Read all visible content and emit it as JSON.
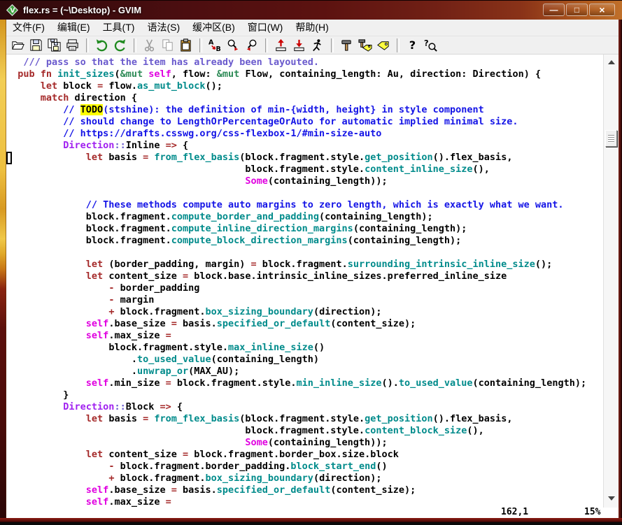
{
  "window": {
    "title": "flex.rs = (~\\Desktop) - GVIM",
    "app": "GVIM",
    "controls": {
      "minimize": "—",
      "maximize": "□",
      "close": "×"
    }
  },
  "menu": {
    "items": [
      {
        "id": "file",
        "label": "文件(F)"
      },
      {
        "id": "edit",
        "label": "编辑(E)"
      },
      {
        "id": "tools",
        "label": "工具(T)"
      },
      {
        "id": "syntax",
        "label": "语法(S)"
      },
      {
        "id": "buffers",
        "label": "缓冲区(B)"
      },
      {
        "id": "window",
        "label": "窗口(W)"
      },
      {
        "id": "help",
        "label": "帮助(H)"
      }
    ]
  },
  "toolbar": {
    "buttons": [
      "open-file",
      "save-file",
      "save-all",
      "print",
      "separator",
      "undo",
      "redo",
      "separator",
      "cut",
      "copy",
      "paste",
      "separator",
      "find-replace",
      "find-next",
      "find-prev",
      "separator",
      "load-session",
      "save-session",
      "run-script",
      "separator",
      "make",
      "build-tags",
      "jump-to-tag",
      "separator",
      "help",
      "find-help"
    ]
  },
  "editor": {
    "cursor": {
      "line_on_screen": 9,
      "column": 1,
      "style": "hollow-block"
    },
    "syntax_colors": {
      "keyword": "#a52a2a",
      "function": "#008b8b",
      "comment": "#1414e6",
      "doc_comment": "#6a5acd",
      "constant": "#e000e0",
      "storage": "#2e8b57",
      "module_path": "#a020f0",
      "todo_fg": "#000000",
      "todo_bg": "#ffff00"
    },
    "lines": [
      {
        "i": 3,
        "t": [
          [
            "d",
            "/// pass so that the item has already been layouted."
          ]
        ]
      },
      {
        "i": 2,
        "t": [
          [
            "k",
            "pub fn "
          ],
          [
            "f",
            "init_sizes"
          ],
          [
            "n",
            "("
          ],
          [
            "g",
            "&mut"
          ],
          [
            "n",
            " "
          ],
          [
            "m",
            "self"
          ],
          [
            "n",
            ", flow: "
          ],
          [
            "g",
            "&mut"
          ],
          [
            "n",
            " Flow, containing_length: Au, direction: Direction) {"
          ]
        ]
      },
      {
        "i": 6,
        "t": [
          [
            "k",
            "let"
          ],
          [
            "n",
            " block "
          ],
          [
            "o",
            "="
          ],
          [
            "n",
            " flow."
          ],
          [
            "f",
            "as_mut_block"
          ],
          [
            "n",
            "();"
          ]
        ]
      },
      {
        "i": 6,
        "t": [
          [
            "k",
            "match"
          ],
          [
            "n",
            " direction {"
          ]
        ]
      },
      {
        "i": 10,
        "t": [
          [
            "c",
            "// "
          ],
          [
            "t",
            "TODO"
          ],
          [
            "c",
            "(stshine): the definition of min-{width, height} in style component"
          ]
        ]
      },
      {
        "i": 10,
        "t": [
          [
            "c",
            "// should change to LengthOrPercentageOrAuto for automatic implied minimal size."
          ]
        ]
      },
      {
        "i": 10,
        "t": [
          [
            "c",
            "// https://drafts.csswg.org/css-flexbox-1/#min-size-auto"
          ]
        ]
      },
      {
        "i": 10,
        "t": [
          [
            "p",
            "Direction"
          ],
          [
            "s",
            "::"
          ],
          [
            "n",
            "Inline "
          ],
          [
            "o",
            "=>"
          ],
          [
            "n",
            " {"
          ]
        ]
      },
      {
        "i": 14,
        "t": [
          [
            "k",
            "let"
          ],
          [
            "n",
            " basis "
          ],
          [
            "o",
            "="
          ],
          [
            "n",
            " "
          ],
          [
            "f",
            "from_flex_basis"
          ],
          [
            "n",
            "(block.fragment.style."
          ],
          [
            "f",
            "get_position"
          ],
          [
            "n",
            "().flex_basis,"
          ]
        ]
      },
      {
        "i": 42,
        "t": [
          [
            "n",
            "block.fragment.style."
          ],
          [
            "f",
            "content_inline_size"
          ],
          [
            "n",
            "(),"
          ]
        ]
      },
      {
        "i": 42,
        "t": [
          [
            "m",
            "Some"
          ],
          [
            "n",
            "(containing_length));"
          ]
        ]
      },
      {
        "i": 0,
        "t": []
      },
      {
        "i": 14,
        "t": [
          [
            "c",
            "// These methods compute auto margins to zero length, which is exactly what we want."
          ]
        ]
      },
      {
        "i": 14,
        "t": [
          [
            "n",
            "block.fragment."
          ],
          [
            "f",
            "compute_border_and_padding"
          ],
          [
            "n",
            "(containing_length);"
          ]
        ]
      },
      {
        "i": 14,
        "t": [
          [
            "n",
            "block.fragment."
          ],
          [
            "f",
            "compute_inline_direction_margins"
          ],
          [
            "n",
            "(containing_length);"
          ]
        ]
      },
      {
        "i": 14,
        "t": [
          [
            "n",
            "block.fragment."
          ],
          [
            "f",
            "compute_block_direction_margins"
          ],
          [
            "n",
            "(containing_length);"
          ]
        ]
      },
      {
        "i": 0,
        "t": []
      },
      {
        "i": 14,
        "t": [
          [
            "k",
            "let"
          ],
          [
            "n",
            " (border_padding, margin) "
          ],
          [
            "o",
            "="
          ],
          [
            "n",
            " block.fragment."
          ],
          [
            "f",
            "surrounding_intrinsic_inline_size"
          ],
          [
            "n",
            "();"
          ]
        ]
      },
      {
        "i": 14,
        "t": [
          [
            "k",
            "let"
          ],
          [
            "n",
            " content_size "
          ],
          [
            "o",
            "="
          ],
          [
            "n",
            " block.base.intrinsic_inline_sizes.preferred_inline_size"
          ]
        ]
      },
      {
        "i": 18,
        "t": [
          [
            "o",
            "-"
          ],
          [
            "n",
            " border_padding"
          ]
        ]
      },
      {
        "i": 18,
        "t": [
          [
            "o",
            "-"
          ],
          [
            "n",
            " margin"
          ]
        ]
      },
      {
        "i": 18,
        "t": [
          [
            "o",
            "+"
          ],
          [
            "n",
            " block.fragment."
          ],
          [
            "f",
            "box_sizing_boundary"
          ],
          [
            "n",
            "(direction);"
          ]
        ]
      },
      {
        "i": 14,
        "t": [
          [
            "m",
            "self"
          ],
          [
            "n",
            ".base_size "
          ],
          [
            "o",
            "="
          ],
          [
            "n",
            " basis."
          ],
          [
            "f",
            "specified_or_default"
          ],
          [
            "n",
            "(content_size);"
          ]
        ]
      },
      {
        "i": 14,
        "t": [
          [
            "m",
            "self"
          ],
          [
            "n",
            ".max_size "
          ],
          [
            "o",
            "="
          ]
        ]
      },
      {
        "i": 18,
        "t": [
          [
            "n",
            "block.fragment.style."
          ],
          [
            "f",
            "max_inline_size"
          ],
          [
            "n",
            "()"
          ]
        ]
      },
      {
        "i": 22,
        "t": [
          [
            "n",
            "."
          ],
          [
            "f",
            "to_used_value"
          ],
          [
            "n",
            "(containing_length)"
          ]
        ]
      },
      {
        "i": 22,
        "t": [
          [
            "n",
            "."
          ],
          [
            "f",
            "unwrap_or"
          ],
          [
            "n",
            "(MAX_AU);"
          ]
        ]
      },
      {
        "i": 14,
        "t": [
          [
            "m",
            "self"
          ],
          [
            "n",
            ".min_size "
          ],
          [
            "o",
            "="
          ],
          [
            "n",
            " block.fragment.style."
          ],
          [
            "f",
            "min_inline_size"
          ],
          [
            "n",
            "()."
          ],
          [
            "f",
            "to_used_value"
          ],
          [
            "n",
            "(containing_length);"
          ]
        ]
      },
      {
        "i": 10,
        "t": [
          [
            "n",
            "}"
          ]
        ]
      },
      {
        "i": 10,
        "t": [
          [
            "p",
            "Direction"
          ],
          [
            "s",
            "::"
          ],
          [
            "n",
            "Block "
          ],
          [
            "o",
            "=>"
          ],
          [
            "n",
            " {"
          ]
        ]
      },
      {
        "i": 14,
        "t": [
          [
            "k",
            "let"
          ],
          [
            "n",
            " basis "
          ],
          [
            "o",
            "="
          ],
          [
            "n",
            " "
          ],
          [
            "f",
            "from_flex_basis"
          ],
          [
            "n",
            "(block.fragment.style."
          ],
          [
            "f",
            "get_position"
          ],
          [
            "n",
            "().flex_basis,"
          ]
        ]
      },
      {
        "i": 42,
        "t": [
          [
            "n",
            "block.fragment.style."
          ],
          [
            "f",
            "content_block_size"
          ],
          [
            "n",
            "(),"
          ]
        ]
      },
      {
        "i": 42,
        "t": [
          [
            "m",
            "Some"
          ],
          [
            "n",
            "(containing_length));"
          ]
        ]
      },
      {
        "i": 14,
        "t": [
          [
            "k",
            "let"
          ],
          [
            "n",
            " content_size "
          ],
          [
            "o",
            "="
          ],
          [
            "n",
            " block.fragment.border_box.size.block"
          ]
        ]
      },
      {
        "i": 18,
        "t": [
          [
            "o",
            "-"
          ],
          [
            "n",
            " block.fragment.border_padding."
          ],
          [
            "f",
            "block_start_end"
          ],
          [
            "n",
            "()"
          ]
        ]
      },
      {
        "i": 18,
        "t": [
          [
            "o",
            "+"
          ],
          [
            "n",
            " block.fragment."
          ],
          [
            "f",
            "box_sizing_boundary"
          ],
          [
            "n",
            "(direction);"
          ]
        ]
      },
      {
        "i": 14,
        "t": [
          [
            "m",
            "self"
          ],
          [
            "n",
            ".base_size "
          ],
          [
            "o",
            "="
          ],
          [
            "n",
            " basis."
          ],
          [
            "f",
            "specified_or_default"
          ],
          [
            "n",
            "(content_size);"
          ]
        ]
      },
      {
        "i": 14,
        "t": [
          [
            "m",
            "self"
          ],
          [
            "n",
            ".max_size "
          ],
          [
            "o",
            "="
          ]
        ]
      }
    ]
  },
  "statusline": {
    "cursor": "162,1",
    "percent": "15%"
  }
}
